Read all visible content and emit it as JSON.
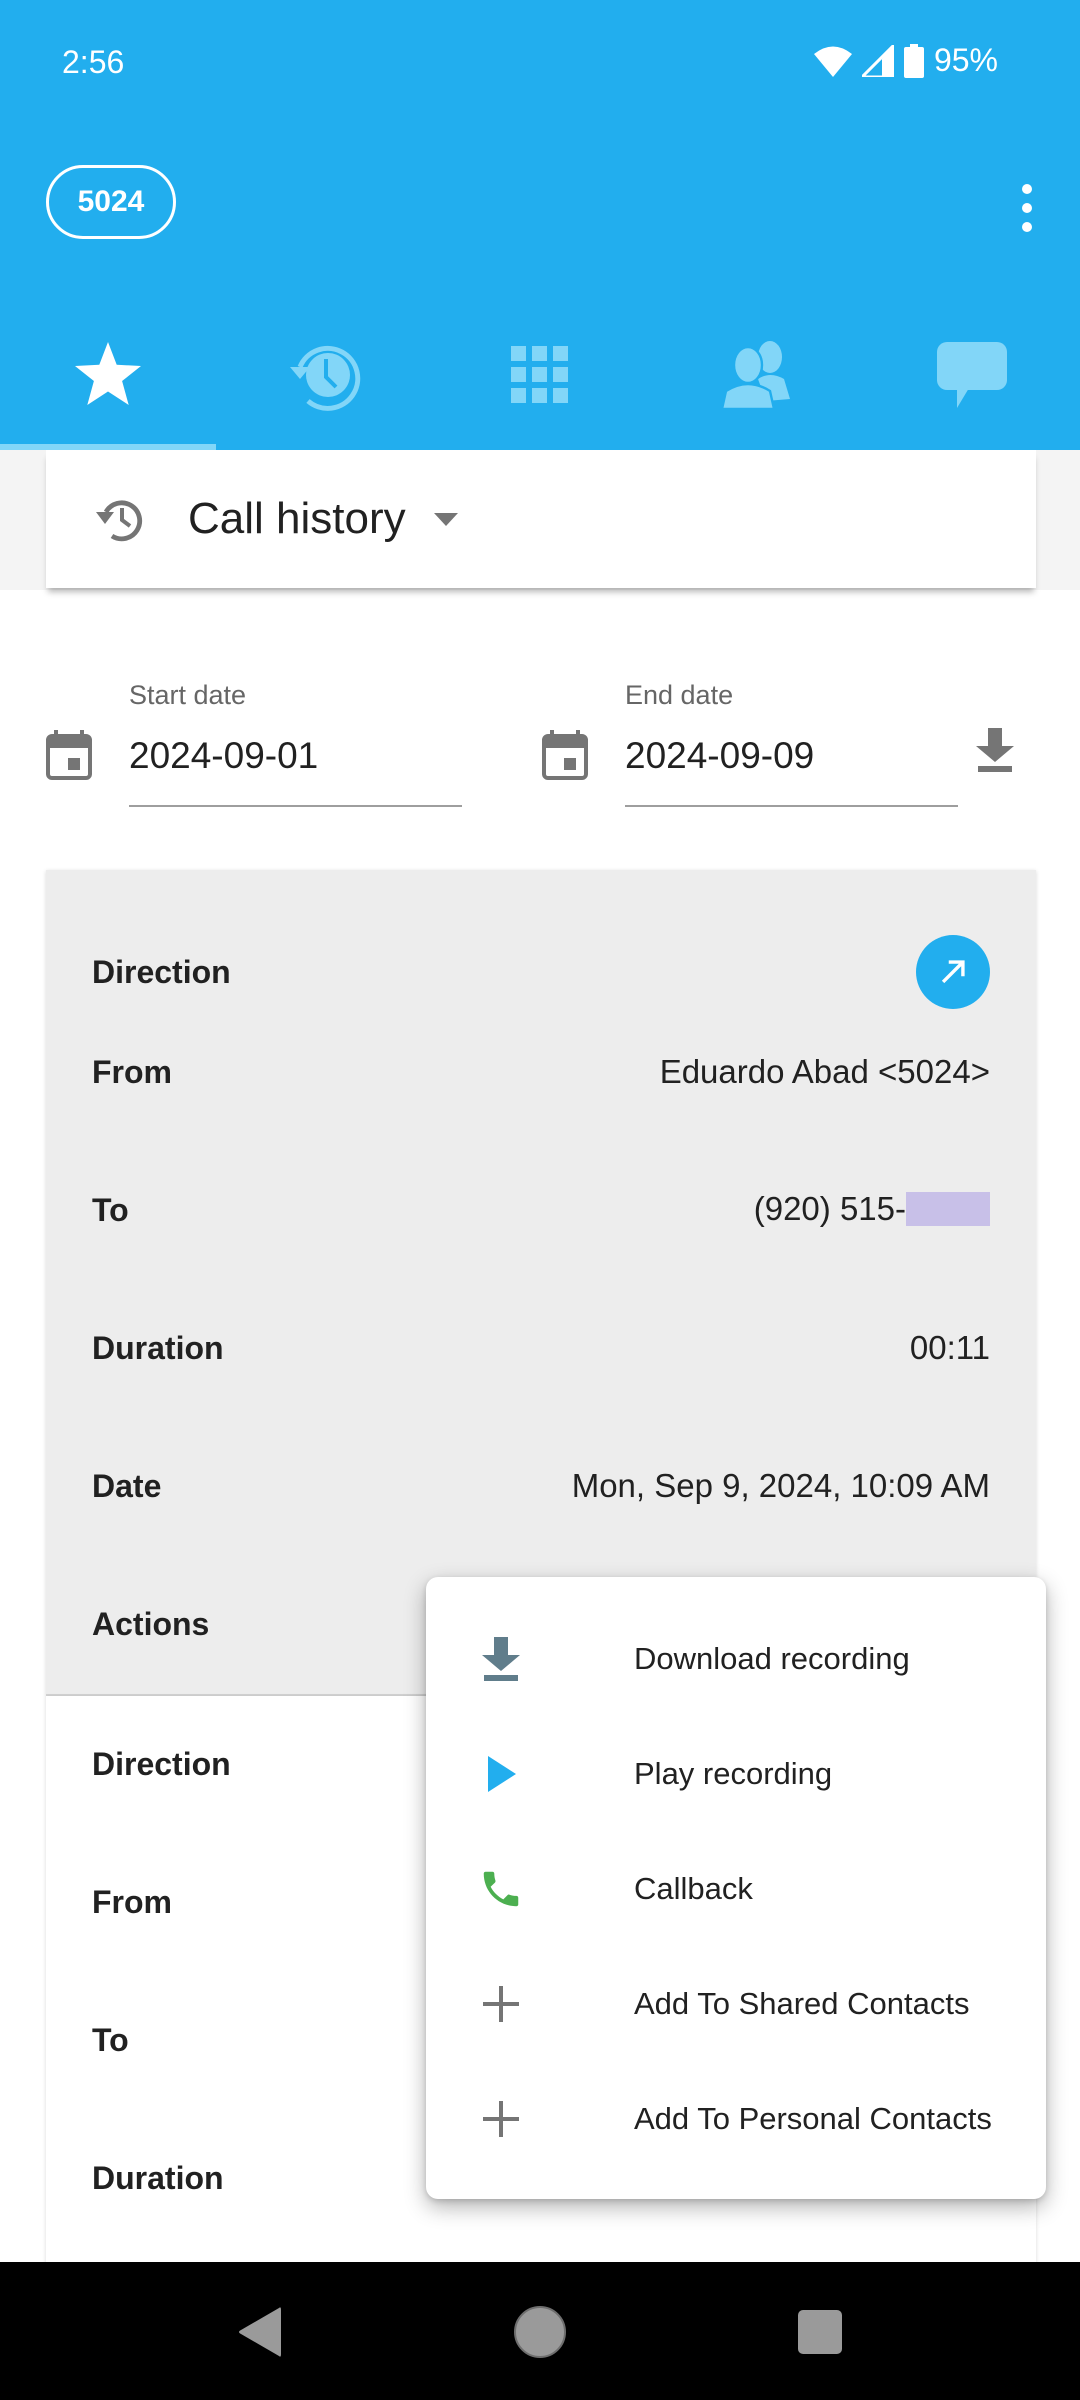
{
  "status_bar": {
    "time": "2:56",
    "battery": "95%",
    "icons": [
      "wifi-icon",
      "cell-signal-icon",
      "battery-icon"
    ]
  },
  "header": {
    "extension_badge": "5024",
    "more_menu_icon": "more-vert-icon",
    "accent_color": "#22AEEE",
    "tabs": [
      {
        "name": "favorites",
        "icon": "star-icon",
        "active": true
      },
      {
        "name": "history",
        "icon": "history-clock-icon",
        "active": false
      },
      {
        "name": "dialpad",
        "icon": "dialpad-icon",
        "active": false
      },
      {
        "name": "contacts",
        "icon": "contacts-icon",
        "active": false
      },
      {
        "name": "messages",
        "icon": "chat-bubble-icon",
        "active": false
      }
    ]
  },
  "section_selector": {
    "icon": "history-icon",
    "title": "Call history"
  },
  "filters": {
    "start_date": {
      "label": "Start date",
      "value": "2024-09-01"
    },
    "end_date": {
      "label": "End date",
      "value": "2024-09-09"
    },
    "download_icon": "download-icon"
  },
  "calls": [
    {
      "direction": {
        "label": "Direction",
        "value": "outgoing",
        "icon": "call-made-icon"
      },
      "from": {
        "label": "From",
        "value": "Eduardo Abad <5024>"
      },
      "to": {
        "label": "To",
        "value": "(920) 515-",
        "redacted": true
      },
      "duration": {
        "label": "Duration",
        "value": "00:11"
      },
      "date": {
        "label": "Date",
        "value": "Mon, Sep 9, 2024, 10:09 AM"
      },
      "actions": {
        "label": "Actions"
      }
    },
    {
      "direction": {
        "label": "Direction"
      },
      "from": {
        "label": "From"
      },
      "to": {
        "label": "To"
      },
      "duration": {
        "label": "Duration"
      }
    }
  ],
  "actions_menu": {
    "items": [
      {
        "label": "Download recording",
        "icon": "download-icon",
        "color": "#607D8B"
      },
      {
        "label": "Play recording",
        "icon": "play-icon",
        "color": "#22AEEE"
      },
      {
        "label": "Callback",
        "icon": "phone-icon",
        "color": "#4CAF50"
      },
      {
        "label": "Add To Shared Contacts",
        "icon": "plus-icon",
        "color": "#757575"
      },
      {
        "label": "Add To Personal Contacts",
        "icon": "plus-icon",
        "color": "#757575"
      }
    ]
  },
  "nav_bar": {
    "buttons": [
      "back-icon",
      "home-icon",
      "recents-icon"
    ]
  }
}
